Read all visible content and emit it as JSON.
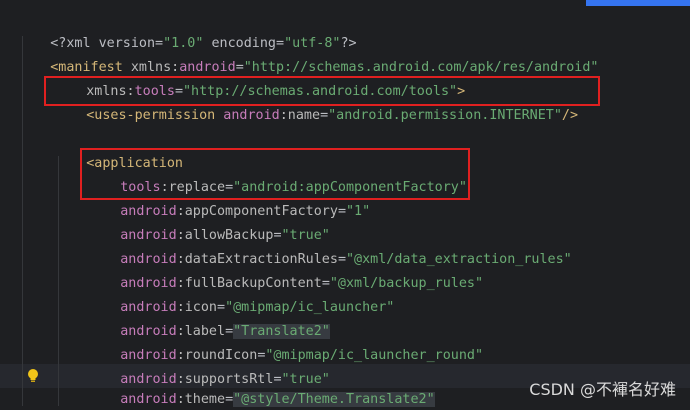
{
  "editor": {
    "lines": [
      {
        "prefix": "<?xml version=",
        "val": "\"1.0\"",
        "mid": " encoding=",
        "val2": "\"utf-8\"",
        "suffix": "?>"
      },
      {
        "tag": "<manifest",
        "nsattr": " xmlns:",
        "ns": "android",
        "eq": "=",
        "val": "\"http://schemas.android.com/apk/res/android\""
      },
      {
        "nsattr": "xmlns:",
        "ns": "tools",
        "eq": "=",
        "val": "\"http://schemas.android.com/tools\"",
        "close": ">"
      },
      {
        "tag": "<uses-permission",
        "ns": " android",
        "attr": ":name",
        "eq": "=",
        "val": "\"android.permission.INTERNET\"",
        "close": "/>"
      },
      {
        "tag": "<application"
      },
      {
        "ns": "tools",
        "attr": ":replace",
        "eq": "=",
        "val": "\"android:appComponentFactory\""
      },
      {
        "ns": "android",
        "attr": ":appComponentFactory",
        "eq": "=",
        "val": "\"1\""
      },
      {
        "ns": "android",
        "attr": ":allowBackup",
        "eq": "=",
        "val": "\"true\""
      },
      {
        "ns": "android",
        "attr": ":dataExtractionRules",
        "eq": "=",
        "val": "\"@xml/data_extraction_rules\""
      },
      {
        "ns": "android",
        "attr": ":fullBackupContent",
        "eq": "=",
        "val": "\"@xml/backup_rules\""
      },
      {
        "ns": "android",
        "attr": ":icon",
        "eq": "=",
        "val": "\"@mipmap/ic_launcher\""
      },
      {
        "ns": "android",
        "attr": ":label",
        "eq": "=",
        "val": "\"Translate2\""
      },
      {
        "ns": "android",
        "attr": ":roundIcon",
        "eq": "=",
        "val": "\"@mipmap/ic_launcher_round\""
      },
      {
        "ns": "android",
        "attr": ":supportsRtl",
        "eq": "=",
        "val": "\"true\""
      },
      {
        "ns": "android",
        "attr": ":theme",
        "eq": "=",
        "val": "\"@style/Theme.Translate2\""
      }
    ]
  },
  "watermark": "CSDN @不褌名好难",
  "icons": {
    "gutter_bulb": "lightbulb-icon"
  },
  "colors": {
    "background": "#1e1f22",
    "tag": "#d5b778",
    "namespace": "#c77dbb",
    "value": "#6aab73",
    "annotation_box": "#e02020"
  }
}
